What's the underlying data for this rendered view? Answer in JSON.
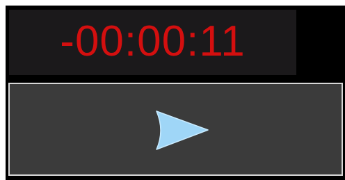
{
  "timer": {
    "display": "-00:00:11"
  },
  "controls": {
    "play_icon": "play-triangle-icon"
  },
  "colors": {
    "background": "#000000",
    "timer_panel": "#1b191b",
    "timer_text": "#d40f0f",
    "button_bg": "#3b3b3b",
    "button_border": "#d8d8d8",
    "play_icon_fill": "#9fd6f7"
  }
}
